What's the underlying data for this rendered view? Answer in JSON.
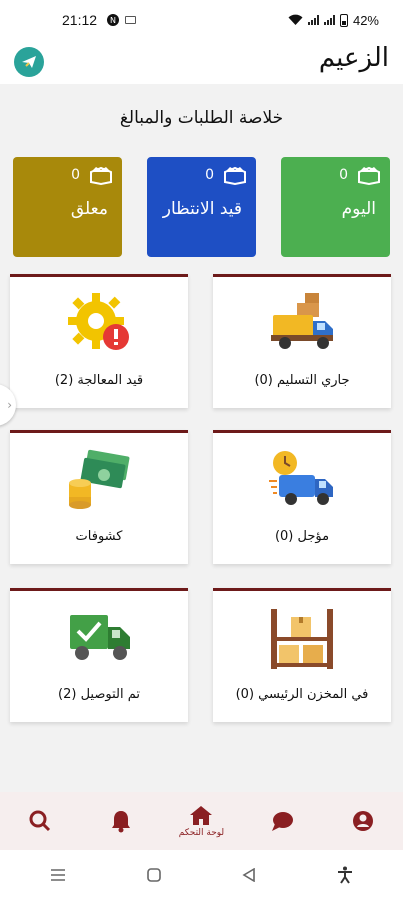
{
  "status_bar": {
    "time": "21:12",
    "battery": "42%"
  },
  "header": {
    "app_title": "الزعيم"
  },
  "summary": {
    "title": "خلاصة الطلبات والمبالغ"
  },
  "stat_cards": [
    {
      "label": "اليوم",
      "count": "0",
      "color": "#4caf50"
    },
    {
      "label": "قيد الانتظار",
      "count": "0",
      "color": "#1e4fc4"
    },
    {
      "label": "معلق",
      "count": "0",
      "color": "#a8890b"
    }
  ],
  "grid": [
    {
      "label": "جاري التسليم (0)",
      "icon": "delivery-truck-icon"
    },
    {
      "label": "قيد المعالجة (2)",
      "icon": "gear-alert-icon"
    },
    {
      "label": "مؤجل (0)",
      "icon": "delayed-truck-icon"
    },
    {
      "label": "كشوفات",
      "icon": "money-coins-icon"
    },
    {
      "label": "في المخزن الرئيسي (0)",
      "icon": "warehouse-shelf-icon"
    },
    {
      "label": "تم التوصيل (2)",
      "icon": "delivered-truck-icon"
    }
  ],
  "bottom_nav": {
    "home_label": "لوحة التحكم"
  },
  "colors": {
    "accent": "#8a1f22",
    "card_border": "#6d1a1a"
  }
}
